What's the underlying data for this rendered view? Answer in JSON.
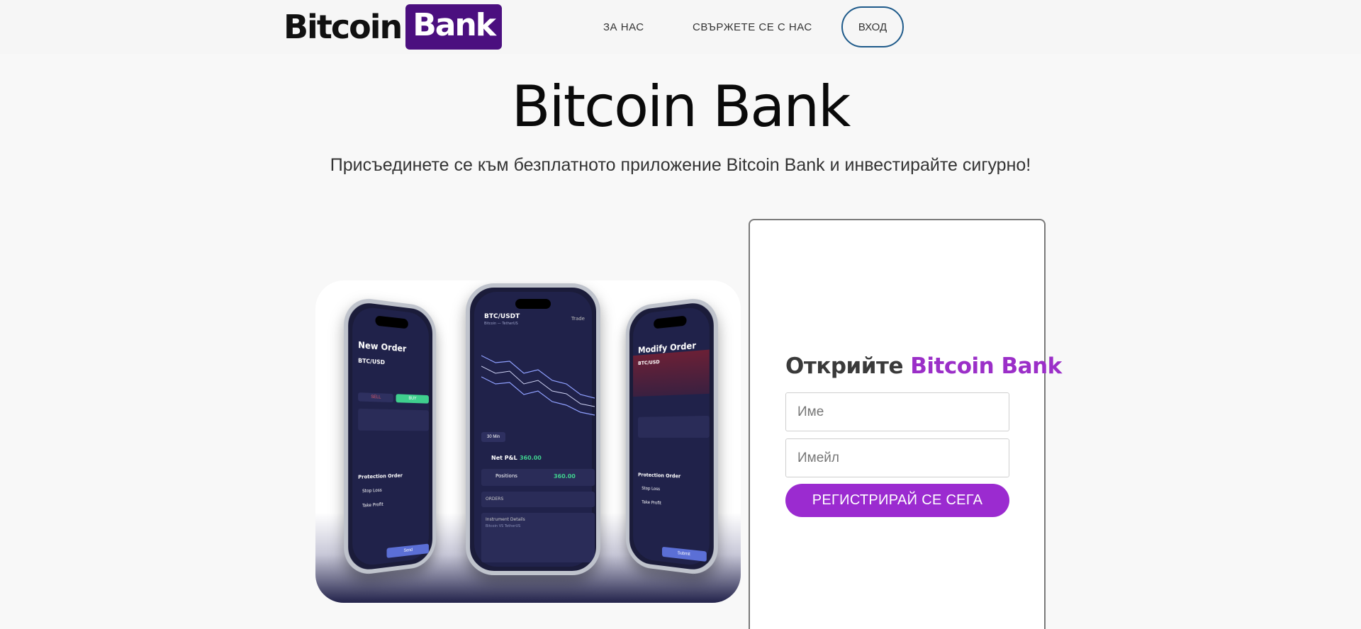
{
  "header": {
    "logo_text": "Bitcoin",
    "logo_badge": "Bank",
    "nav": {
      "about": "ЗА НАС",
      "contact": "СВЪРЖЕТЕ СЕ С НАС",
      "login": "ВХОД"
    }
  },
  "hero": {
    "title": "Bitcoin Bank",
    "subtitle": "Присъединете се към безплатното приложение Bitcoin Bank и инвестирайте сигурно!"
  },
  "phones": {
    "left": {
      "title": "New Order",
      "pair": "BTC/USD",
      "buy": "BUY",
      "sell": "SELL",
      "protection": "Protection Order",
      "stop_loss": "Stop Loss",
      "take_profit": "Take Profit",
      "send": "Send"
    },
    "middle": {
      "pair": "BTC/USDT",
      "pair_sub": "Bitcoin — TetherUS",
      "trade": "Trade",
      "timeframe": "30 Min",
      "net_pl_label": "Net P&L",
      "net_pl_value": "360.00",
      "positions_label": "Positions",
      "positions_value": "360.00",
      "orders": "ORDERS",
      "instrument": "Instrument Details",
      "instrument_sub": "Bitcoin VS TetherUS"
    },
    "right": {
      "title": "Modify Order",
      "pair": "BTC/USD",
      "protection": "Protection Order",
      "stop_loss": "Stop Loss",
      "take_profit": "Take Profit",
      "submit": "Submit"
    },
    "colors": {
      "screen": "#20224a",
      "buy": "#3fcf8e",
      "sell": "#e05a6a",
      "button": "#5b6fd6"
    }
  },
  "form": {
    "title_prefix": "Открийте",
    "title_accent": "Bitcoin Bank",
    "name_placeholder": "Име",
    "email_placeholder": "Имейл",
    "submit_label": "РЕГИСТРИРАЙ СЕ СЕГА"
  },
  "colors": {
    "brand_purple": "#4b0f7f",
    "accent_purple": "#9b2fc8",
    "login_border": "#1e5a8a"
  }
}
